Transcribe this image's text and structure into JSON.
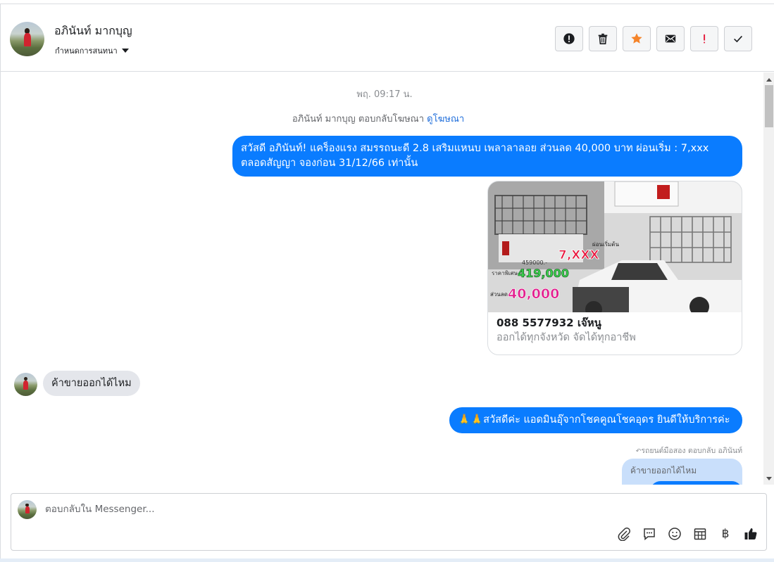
{
  "header": {
    "contact_name": "อภินันท์ มากบุญ",
    "assign_label": "กำหนดการสนทนา",
    "actions": [
      {
        "name": "report-icon"
      },
      {
        "name": "trash-icon"
      },
      {
        "name": "star-icon",
        "color": "#f5842a"
      },
      {
        "name": "envelope-icon"
      },
      {
        "name": "exclamation-icon",
        "color": "#e41e3f"
      },
      {
        "name": "checkmark-icon"
      }
    ]
  },
  "chat": {
    "timestamp": "พฤ. 09:17 น.",
    "ad_reply_text": "อภินันท์ มากบุญ ตอบกลับโฆษณา",
    "ad_reply_link": "ดูโฆษณา",
    "messages": [
      {
        "direction": "out",
        "text": "สวัสดี อภินันท์! แคร็องแรง สมรรถนะดี 2.8 เสริมแหนบ เพลาลาลอย ส่วนลด 40,000 บาท ผ่อนเริ่ม : 7,xxx ตลอดสัญญา จองก่อน 31/12/66 เท่านั้น"
      },
      {
        "direction": "in",
        "text": "ค้าขายออกได้ไหม"
      },
      {
        "direction": "out",
        "text": "🙏🙏สวัสดีค่ะ แอดมินอุ๊จากโชคคูณโชคอุดร ยินดีให้บริการค่ะ"
      }
    ],
    "card": {
      "title": "088 5577932 เจ๊หนู",
      "subtitle": "ออกได้ทุกจังหวัด จัดได้ทุกอาชีพ",
      "image_text": {
        "installment_label": "ผ่อนเริ่มต้น",
        "installment_value": "7,XXX",
        "old_price": "459000.-",
        "sale_label": "ราคาพิเศษ",
        "sale_value": "419,000",
        "discount_label": "ส่วนลด",
        "discount_value": "40,000"
      }
    },
    "reply_note": "รถยนต์มือสอง ตอบกลับ อภินันท์",
    "quoted_text": "ค้าขายออกได้ไหม"
  },
  "composer": {
    "placeholder": "ตอบกลับใน Messenger...",
    "tools": [
      "attachment-icon",
      "saved-reply-icon",
      "emoji-icon",
      "calendar-icon",
      "baht-icon",
      "thumbs-up-icon"
    ],
    "baht_symbol": "฿"
  },
  "colors": {
    "accent": "#0a7cff",
    "incoming_bubble": "#e4e6eb",
    "quote_bubble": "#c9dffb",
    "star": "#f5842a",
    "alert": "#e41e3f"
  }
}
